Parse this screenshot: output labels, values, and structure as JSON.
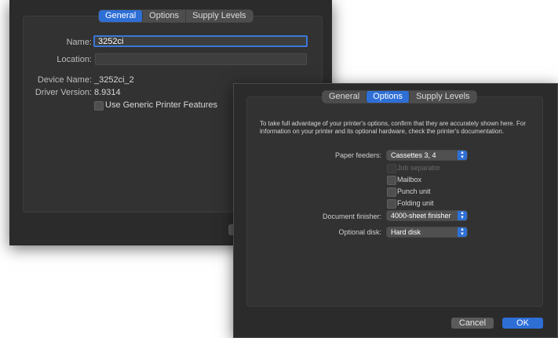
{
  "back_window": {
    "tabs": [
      {
        "label": "General",
        "active": true
      },
      {
        "label": "Options",
        "active": false
      },
      {
        "label": "Supply Levels",
        "active": false
      }
    ],
    "name_label": "Name:",
    "name_value": "3252ci",
    "location_label": "Location:",
    "location_value": "",
    "device_name_label": "Device Name:",
    "device_name_value": "_3252ci_2",
    "driver_version_label": "Driver Version:",
    "driver_version_value": "8.9314",
    "generic_features_label": "Use Generic Printer Features"
  },
  "front_window": {
    "tabs": [
      {
        "label": "General",
        "active": false
      },
      {
        "label": "Options",
        "active": true
      },
      {
        "label": "Supply Levels",
        "active": false
      }
    ],
    "description": "To take full advantage of your printer's options, confirm that they are accurately shown here. For information on your printer and its optional hardware, check the printer's documentation.",
    "paper_feeders_label": "Paper feeders:",
    "paper_feeders_value": "Cassettes 3, 4",
    "checkboxes": [
      {
        "label": "Job separator",
        "enabled": false
      },
      {
        "label": "Mailbox",
        "enabled": true
      },
      {
        "label": "Punch unit",
        "enabled": true
      },
      {
        "label": "Folding unit",
        "enabled": true
      }
    ],
    "document_finisher_label": "Document finisher:",
    "document_finisher_value": "4000-sheet finisher",
    "optional_disk_label": "Optional disk:",
    "optional_disk_value": "Hard disk",
    "cancel_label": "Cancel",
    "ok_label": "OK"
  },
  "colors": {
    "accent": "#2e6fd6",
    "window_bg": "#2b2b2b",
    "panel_bg": "#323232"
  }
}
